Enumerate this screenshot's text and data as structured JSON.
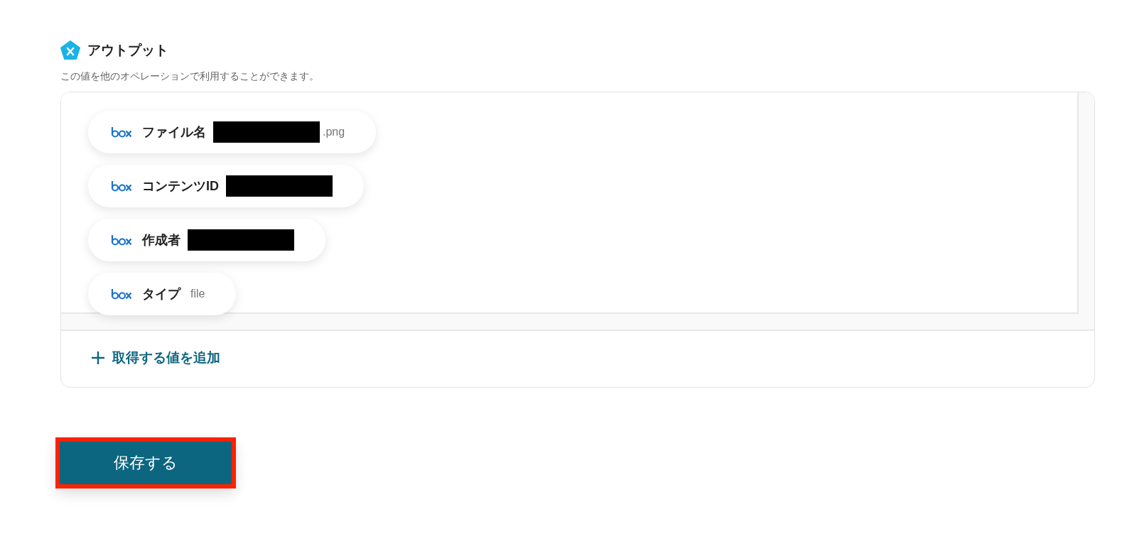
{
  "section": {
    "title": "アウトプット",
    "description": "この値を他のオペレーションで利用することができます。"
  },
  "outputs": [
    {
      "label": "ファイル名",
      "redacted": true,
      "value": ".png"
    },
    {
      "label": "コンテンツID",
      "redacted": true
    },
    {
      "label": "作成者",
      "redacted": true
    },
    {
      "label": "タイプ",
      "redacted": false,
      "value": "file"
    }
  ],
  "add_button": {
    "label": "取得する値を追加"
  },
  "save_button": {
    "label": "保存する",
    "highlighted": true
  }
}
